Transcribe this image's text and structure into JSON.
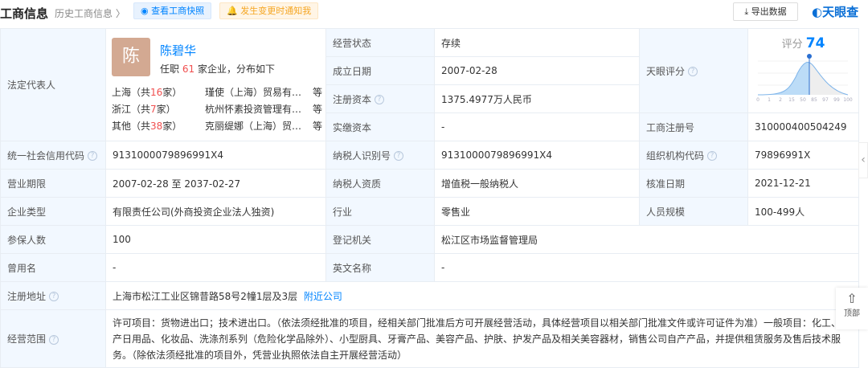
{
  "header": {
    "title": "工商信息",
    "history": "历史工商信息",
    "snapshot_btn": "查看工商快照",
    "notify_btn": "发生变更时通知我",
    "export_btn": "导出数据",
    "brand": "天眼查"
  },
  "legal_rep": {
    "label": "法定代表人",
    "avatar_char": "陈",
    "name": "陈碧华",
    "info_prefix": "任职",
    "count": "61",
    "info_suffix": "家企业，分布如下",
    "dist": [
      {
        "region": "上海（共",
        "n": "16",
        "tail": "家）",
        "company": "瑾使（上海）贸易有…",
        "etc": "等"
      },
      {
        "region": "浙江（共",
        "n": "7",
        "tail": "家）",
        "company": "杭州怀素投资管理有…",
        "etc": "等"
      },
      {
        "region": "其他（共",
        "n": "38",
        "tail": "家）",
        "company": "克丽缇娜（上海）贸…",
        "etc": "等"
      }
    ]
  },
  "top_fields": [
    {
      "label": "经营状态",
      "value": "存续"
    },
    {
      "label": "成立日期",
      "value": "2007-02-28"
    },
    {
      "label": "注册资本",
      "value": "1375.4977万人民币"
    },
    {
      "label": "实缴资本",
      "value": "-"
    }
  ],
  "score": {
    "label": "天眼评分",
    "title": "评分",
    "value": "74",
    "ticks": [
      "0",
      "1",
      "2",
      "15",
      "50",
      "85",
      "97",
      "99",
      "100"
    ],
    "accent": "#0084ff"
  },
  "reg_no": {
    "label": "工商注册号",
    "value": "310000400504249"
  },
  "rows": [
    [
      {
        "label": "统一社会信用代码",
        "value": "9131000079896991X4",
        "q": true
      },
      {
        "label": "纳税人识别号",
        "value": "9131000079896991X4",
        "q": true
      },
      {
        "label": "组织机构代码",
        "value": "79896991X",
        "q": true
      }
    ],
    [
      {
        "label": "营业期限",
        "value": "2007-02-28  至 2037-02-27"
      },
      {
        "label": "纳税人资质",
        "value": "增值税一般纳税人"
      },
      {
        "label": "核准日期",
        "value": "2021-12-21"
      }
    ],
    [
      {
        "label": "企业类型",
        "value": "有限责任公司(外商投资企业法人独资)"
      },
      {
        "label": "行业",
        "value": "零售业"
      },
      {
        "label": "人员规模",
        "value": "100-499人"
      }
    ],
    [
      {
        "label": "参保人数",
        "value": "100"
      },
      {
        "label": "登记机关",
        "value": "松江区市场监督管理局"
      }
    ],
    [
      {
        "label": "曾用名",
        "value": "-"
      },
      {
        "label": "英文名称",
        "value": "-"
      }
    ]
  ],
  "address": {
    "label": "注册地址",
    "value": "上海市松江工业区锦昔路58号2幢1层及3层",
    "link": "附近公司"
  },
  "scope": {
    "label": "经营范围",
    "value": "许可项目：货物进出口；技术进出口。（依法须经批准的项目，经相关部门批准后方可开展经营活动，具体经营项目以相关部门批准文件或许可证件为准）一般项目：化工、生产日用品、化妆品、洗涤剂系列（危险化学品除外）、小型厨具、牙膏产品、美容产品、护肤、护发产品及相关美容器材，销售公司自产产品，并提供租赁服务及售后技术服务。（除依法须经批准的项目外，凭营业执照依法自主开展经营活动）"
  },
  "side": {
    "back_top": "顶部"
  }
}
